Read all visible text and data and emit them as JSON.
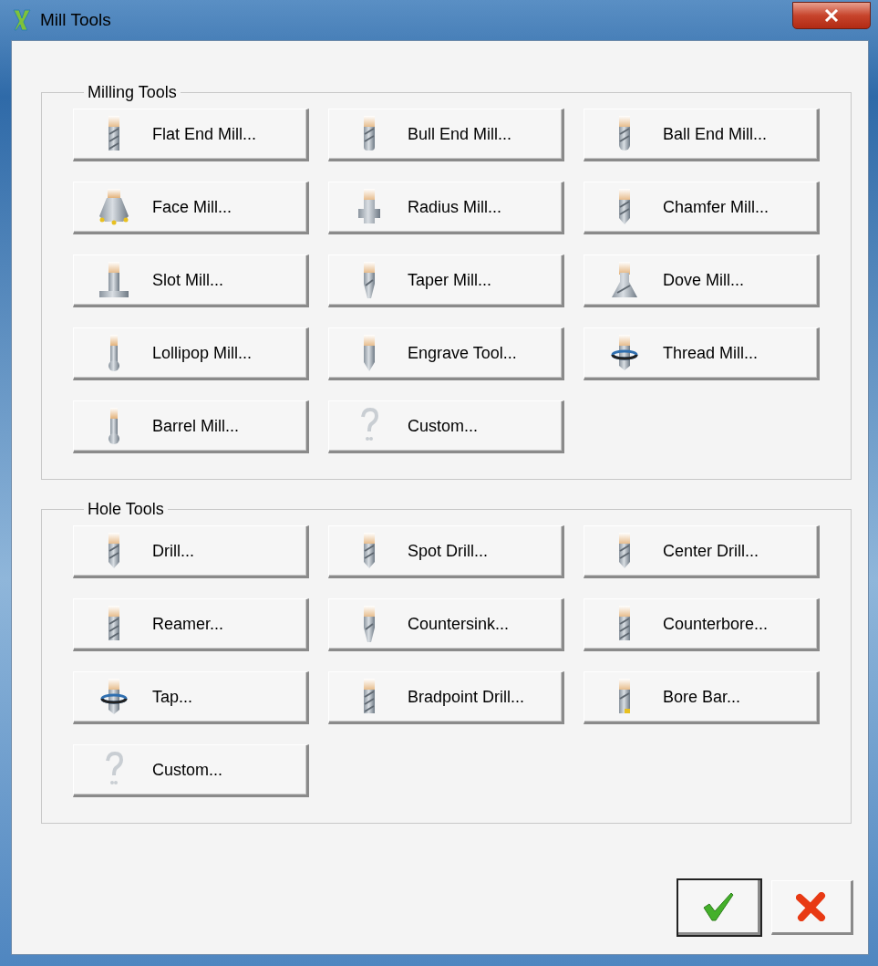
{
  "window": {
    "title": "Mill Tools"
  },
  "groups": [
    {
      "label": "Milling Tools",
      "tools": [
        {
          "label": "Flat End Mill...",
          "kind": "flat"
        },
        {
          "label": "Bull End Mill...",
          "kind": "bull"
        },
        {
          "label": "Ball End Mill...",
          "kind": "ball"
        },
        {
          "label": "Face Mill...",
          "kind": "face"
        },
        {
          "label": "Radius Mill...",
          "kind": "radius"
        },
        {
          "label": "Chamfer Mill...",
          "kind": "chamfer"
        },
        {
          "label": "Slot Mill...",
          "kind": "slot"
        },
        {
          "label": "Taper Mill...",
          "kind": "taper"
        },
        {
          "label": "Dove Mill...",
          "kind": "dove"
        },
        {
          "label": "Lollipop Mill...",
          "kind": "lollipop"
        },
        {
          "label": "Engrave Tool...",
          "kind": "engrave"
        },
        {
          "label": "Thread Mill...",
          "kind": "thread"
        },
        {
          "label": "Barrel Mill...",
          "kind": "lollipop"
        },
        {
          "label": "Custom...",
          "kind": "custom"
        }
      ]
    },
    {
      "label": "Hole Tools",
      "tools": [
        {
          "label": "Drill...",
          "kind": "chamfer"
        },
        {
          "label": "Spot Drill...",
          "kind": "chamfer"
        },
        {
          "label": "Center Drill...",
          "kind": "chamfer"
        },
        {
          "label": "Reamer...",
          "kind": "flat"
        },
        {
          "label": "Countersink...",
          "kind": "taper"
        },
        {
          "label": "Counterbore...",
          "kind": "flat"
        },
        {
          "label": "Tap...",
          "kind": "thread"
        },
        {
          "label": "Bradpoint Drill...",
          "kind": "flat"
        },
        {
          "label": "Bore Bar...",
          "kind": "bore"
        },
        {
          "label": "Custom...",
          "kind": "custom"
        }
      ]
    }
  ],
  "buttons": [
    {
      "kind": "ok",
      "default": true
    },
    {
      "kind": "cancel",
      "default": false
    }
  ]
}
